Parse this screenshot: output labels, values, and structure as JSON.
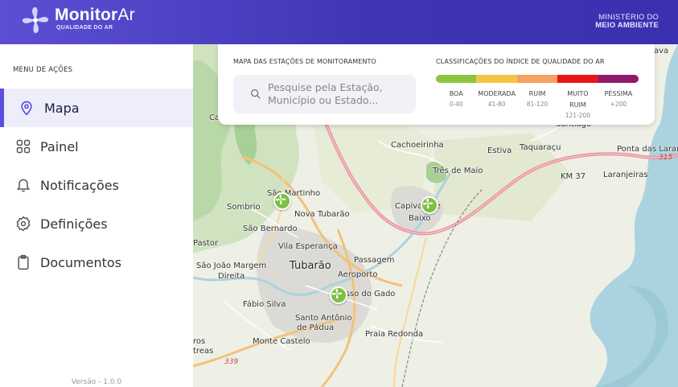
{
  "header": {
    "brand_bold": "Monitor",
    "brand_light": "Ar",
    "brand_subtitle": "QUALIDADE DO AR",
    "ministry_line1": "MINISTÉRIO DO",
    "ministry_line2": "MEIO AMBIENTE"
  },
  "sidebar": {
    "title": "MENU DE AÇÕES",
    "items": [
      {
        "label": "Mapa",
        "icon": "map-pin-icon",
        "active": true
      },
      {
        "label": "Painel",
        "icon": "grid-icon",
        "active": false
      },
      {
        "label": "Notificações",
        "icon": "bell-icon",
        "active": false
      },
      {
        "label": "Definições",
        "icon": "settings-icon",
        "active": false
      },
      {
        "label": "Documentos",
        "icon": "clipboard-icon",
        "active": false
      }
    ],
    "version": "Versão - 1.0.0"
  },
  "panel": {
    "map_title": "MAPA DAS ESTAÇÕES DE MONITORAMENTO",
    "search_placeholder": "Pesquise pela Estação, Município ou Estado...",
    "classification_title": "CLASSIFICAÇÕES DO ÍNDICE DE QUALIDADE DO AR",
    "classes": [
      {
        "name": "BOA",
        "range": "0-40",
        "color": "#8cc63f"
      },
      {
        "name": "MODERADA",
        "range": "41-80",
        "color": "#f4c542"
      },
      {
        "name": "RUIM",
        "range": "81-120",
        "color": "#f4a261"
      },
      {
        "name": "MUITO RUIM",
        "range": "121-200",
        "color": "#e8161b"
      },
      {
        "name": "PÉSSIMA",
        "range": "+200",
        "color": "#8e1a6e"
      }
    ]
  },
  "map": {
    "labels": {
      "vava": "ava",
      "cachoeirinha": "Cachoeirinha",
      "estiva": "Estiva",
      "taquaracu": "Taquaraçu",
      "ponta_das_laranjeiras": "Ponta das Laran",
      "santiago": "Santiago",
      "tres_de_maio": "Três de Maio",
      "km37": "KM 37",
      "laranjeiras": "Laranjeiras",
      "road315": "315",
      "sao_martinho": "São Martinho",
      "capivari": "Capivari de",
      "capivari_baixo": "Baixo",
      "sombrio": "Sombrio",
      "nova_tubarao": "Nova Tubarão",
      "sao_bernardo": "São Bernardo",
      "pastor": "Pastor",
      "vila_esperanca": "Vila Esperança",
      "sao_joao_margem": "São João Margem",
      "direita": "Direita",
      "tubarao": "Tubarão",
      "passagem": "Passagem",
      "aeroporto": "Aeroporto",
      "passo_do_gado": "Passo do Gado",
      "fabio_silva": "Fábio Silva",
      "santo_antonio": "Santo Antônio",
      "de_padua": "de Pádua",
      "praia_redonda": "Praia Redonda",
      "monte_castelo": "Monte Castelo",
      "ros": "ros",
      "treas": "treas",
      "road339": "339",
      "ca": "Ca"
    },
    "stations": [
      {
        "name": "estação São Martinho",
        "quality": "BOA"
      },
      {
        "name": "estação Capivari de Baixo",
        "quality": "BOA"
      },
      {
        "name": "estação Tubarão",
        "quality": "BOA"
      }
    ]
  }
}
